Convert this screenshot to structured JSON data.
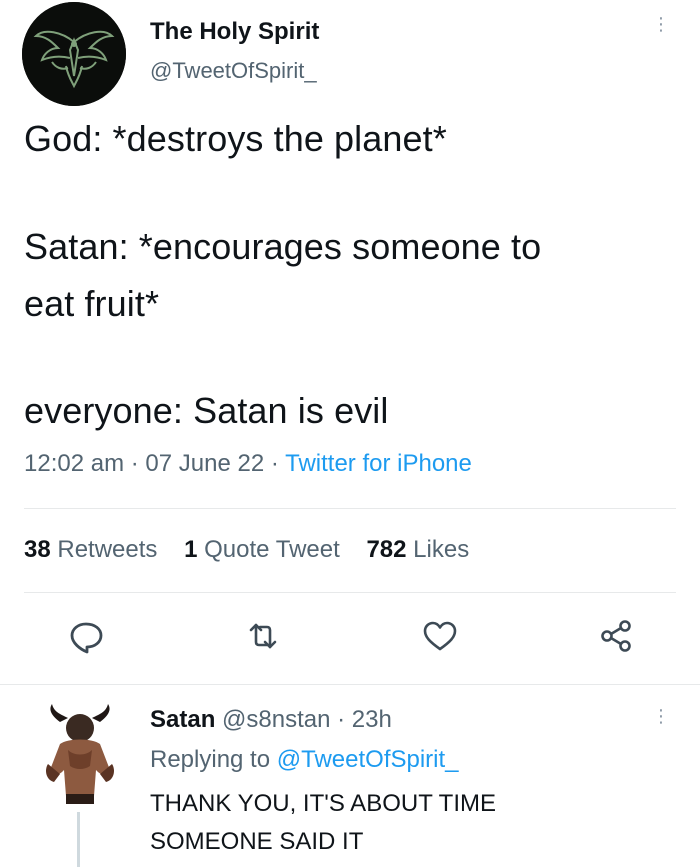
{
  "author": {
    "name": "The Holy Spirit",
    "handle": "@TweetOfSpirit_",
    "avatar_icon": "phoenix-bird-icon"
  },
  "tweet": {
    "lines": [
      "God: *destroys the planet*",
      "Satan: *encourages someone to",
      "eat fruit*",
      "everyone: Satan is evil"
    ],
    "time": "12:02 am",
    "date": "07 June 22",
    "source": "Twitter for iPhone"
  },
  "stats": {
    "retweets_count": "38",
    "retweets_label": "Retweets",
    "quotes_count": "1",
    "quotes_label": "Quote Tweet",
    "likes_count": "782",
    "likes_label": "Likes"
  },
  "actions": [
    "reply-icon",
    "retweet-icon",
    "like-icon",
    "share-icon"
  ],
  "reply": {
    "name": "Satan",
    "handle": "@s8nstan",
    "age": "23h",
    "replying_label": "Replying to",
    "replying_to": "@TweetOfSpirit_",
    "text_lines": [
      "THANK YOU, IT'S ABOUT TIME",
      "SOMEONE SAID IT"
    ],
    "avatar_icon": "demon-figure-icon"
  },
  "colors": {
    "text": "#0f1419",
    "secondary": "#536471",
    "link": "#1d9bf0",
    "divider": "#e7e9ea"
  }
}
